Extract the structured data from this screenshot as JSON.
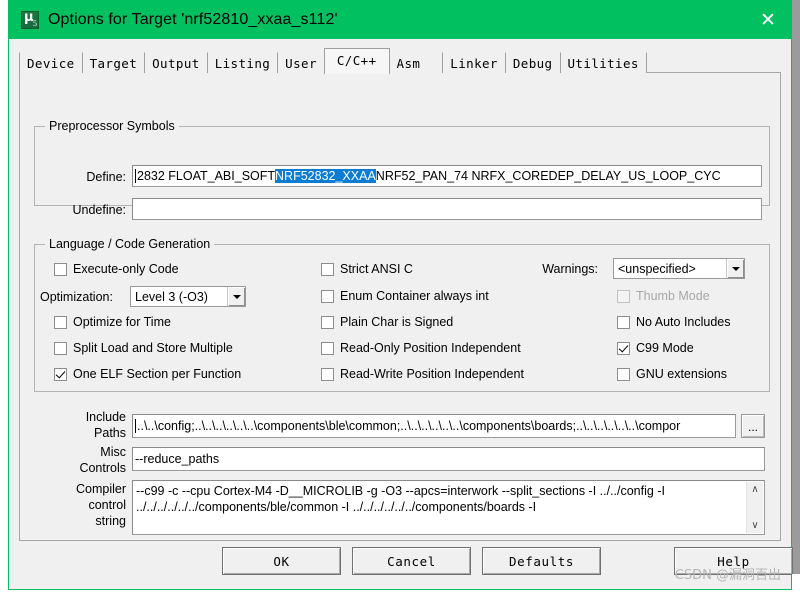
{
  "window": {
    "title": "Options for Target 'nrf52810_xxaa_s112'",
    "icon": "keil-uvision-icon",
    "close_label": "✕",
    "titlebar_color": "#00c060"
  },
  "tabs": [
    {
      "label": "Device",
      "active": false
    },
    {
      "label": "Target",
      "active": false
    },
    {
      "label": "Output",
      "active": false
    },
    {
      "label": "Listing",
      "active": false
    },
    {
      "label": "User",
      "active": false
    },
    {
      "label": "C/C++",
      "active": true
    },
    {
      "label": "Asm",
      "active": false
    },
    {
      "label": "Linker",
      "active": false
    },
    {
      "label": "Debug",
      "active": false
    },
    {
      "label": "Utilities",
      "active": false
    }
  ],
  "preprocessor": {
    "group_title": "Preprocessor Symbols",
    "define_label": "Define:",
    "define_value_before": "2832 FLOAT_ABI_SOFT ",
    "define_value_selected": "NRF52832_XXAA",
    "define_value_after": " NRF52_PAN_74 NRFX_COREDEP_DELAY_US_LOOP_CYC",
    "selection_color": "#0a7cd4",
    "undefine_label": "Undefine:",
    "undefine_value": ""
  },
  "language": {
    "group_title": "Language / Code Generation",
    "left_checks": [
      {
        "label": "Execute-only Code",
        "checked": false,
        "disabled": false
      },
      {
        "label": "Optimize for Time",
        "checked": false,
        "disabled": false
      },
      {
        "label": "Split Load and Store Multiple",
        "checked": false,
        "disabled": false
      },
      {
        "label": "One ELF Section per Function",
        "checked": true,
        "disabled": false
      }
    ],
    "optimization_label": "Optimization:",
    "optimization_value": "Level 3 (-O3)",
    "middle_checks": [
      {
        "label": "Strict ANSI C",
        "checked": false,
        "disabled": false
      },
      {
        "label": "Enum Container always int",
        "checked": false,
        "disabled": false
      },
      {
        "label": "Plain Char is Signed",
        "checked": false,
        "disabled": false
      },
      {
        "label": "Read-Only Position Independent",
        "checked": false,
        "disabled": false
      },
      {
        "label": "Read-Write Position Independent",
        "checked": false,
        "disabled": false
      }
    ],
    "warnings_label": "Warnings:",
    "warnings_value": "<unspecified>",
    "right_checks": [
      {
        "label": "Thumb Mode",
        "checked": false,
        "disabled": true
      },
      {
        "label": "No Auto Includes",
        "checked": false,
        "disabled": false
      },
      {
        "label": "C99 Mode",
        "checked": true,
        "disabled": false
      },
      {
        "label": "GNU extensions",
        "checked": false,
        "disabled": false
      }
    ]
  },
  "paths": {
    "include_label_line1": "Include",
    "include_label_line2": "Paths",
    "include_value": "..\\..\\config;..\\..\\..\\..\\..\\..\\components\\ble\\common;..\\..\\..\\..\\..\\..\\components\\boards;..\\..\\..\\..\\..\\..\\compor",
    "browse_label": "...",
    "misc_label_line1": "Misc",
    "misc_label_line2": "Controls",
    "misc_value": "--reduce_paths",
    "compiler_label_line1": "Compiler",
    "compiler_label_line2": "control",
    "compiler_label_line3": "string",
    "compiler_value_line1": "--c99 -c --cpu Cortex-M4 -D__MICROLIB -g -O3 --apcs=interwork --split_sections -I ../../config -I",
    "compiler_value_line2": "../../../../../../components/ble/common -I ../../../../../../components/boards -I",
    "scroll_up": "∧",
    "scroll_down": "∨"
  },
  "buttons": {
    "ok": "OK",
    "cancel": "Cancel",
    "defaults": "Defaults",
    "help": "Help"
  },
  "watermark": "CSDN @漏洞百出"
}
